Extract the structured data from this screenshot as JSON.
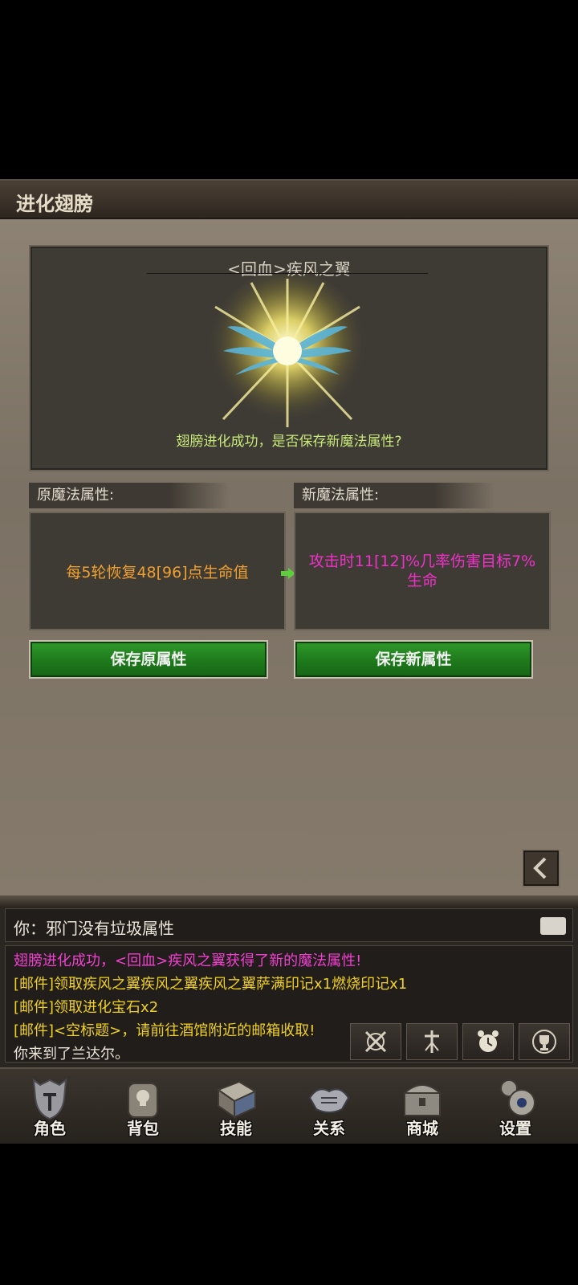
{
  "window": {
    "title": "进化翅膀"
  },
  "preview": {
    "wing_name": "<回血>疾风之翼",
    "message": "翅膀进化成功，是否保存新魔法属性?"
  },
  "old_attr": {
    "header": "原魔法属性:",
    "text": "每5轮恢复48[96]点生命值",
    "color": "#f0a030"
  },
  "new_attr": {
    "header": "新魔法属性:",
    "text": "攻击时11[12]%几率伤害目标7%生命",
    "color": "#f030c8"
  },
  "buttons": {
    "save_old": "保存原属性",
    "save_new": "保存新属性"
  },
  "chat": {
    "input_text": "你：邪门没有垃圾属性",
    "log": [
      {
        "text": "翅膀进化成功，<回血>疾风之翼获得了新的魔法属性!",
        "color": "#f040d0"
      },
      {
        "text": "[邮件]领取疾风之翼疾风之翼疾风之翼萨满印记x1燃烧印记x1",
        "color": "#f0d020"
      },
      {
        "text": "[邮件]领取进化宝石x2",
        "color": "#f0d020"
      },
      {
        "text": "[邮件]<空标题>，请前往酒馆附近的邮箱收取!",
        "color": "#f0d020"
      },
      {
        "text": "你来到了兰达尔。",
        "color": "#ece6da"
      }
    ]
  },
  "quick_icons": [
    "crossed-swords-icon",
    "sword-icon",
    "alarm-clock-icon",
    "trophy-icon"
  ],
  "nav": [
    {
      "label": "角色",
      "icon": "helmet-icon"
    },
    {
      "label": "背包",
      "icon": "backpack-icon"
    },
    {
      "label": "技能",
      "icon": "skill-book-icon"
    },
    {
      "label": "关系",
      "icon": "handshake-icon"
    },
    {
      "label": "商城",
      "icon": "shop-chest-icon"
    },
    {
      "label": "设置",
      "icon": "gear-icon"
    }
  ]
}
